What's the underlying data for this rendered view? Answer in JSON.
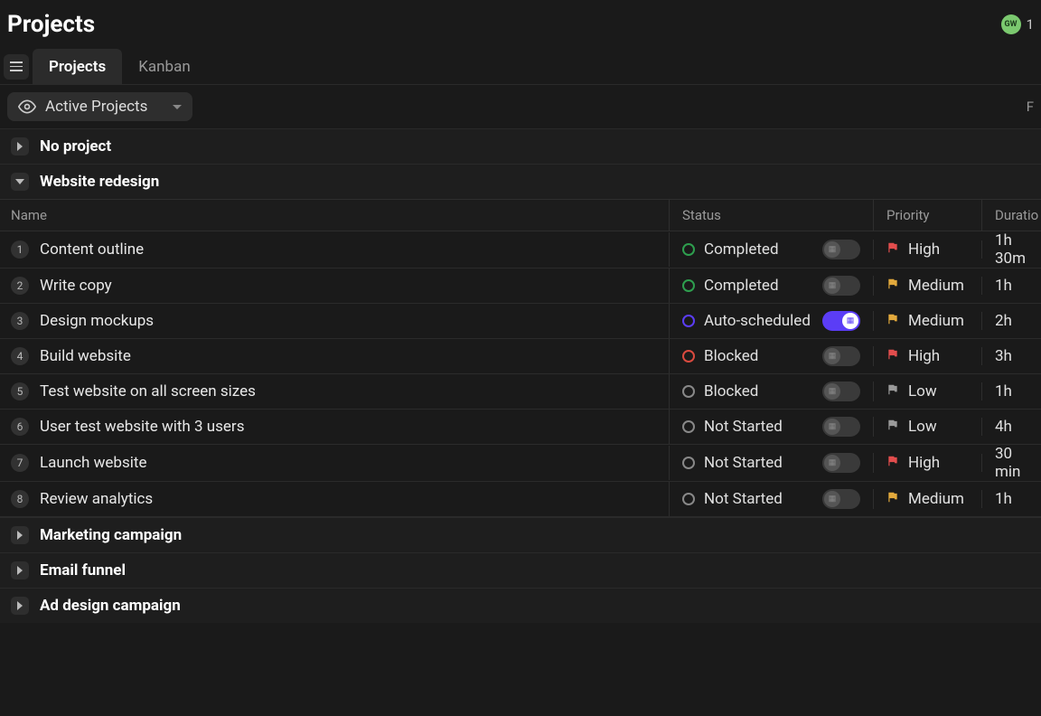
{
  "header": {
    "title": "Projects",
    "avatar_initials": "GW",
    "count_fragment": "1"
  },
  "tabs": [
    {
      "label": "Projects",
      "active": true
    },
    {
      "label": "Kanban",
      "active": false
    }
  ],
  "filter": {
    "label": "Active Projects",
    "right_fragment": "F"
  },
  "columns": {
    "name": "Name",
    "status": "Status",
    "priority": "Priority",
    "duration": "Duratio"
  },
  "groups": [
    {
      "title": "No project",
      "expanded": false
    },
    {
      "title": "Website redesign",
      "expanded": true,
      "tasks": [
        {
          "num": "1",
          "name": "Content outline",
          "status": "Completed",
          "status_color": "#2e9e4e",
          "toggle_on": false,
          "priority": "High",
          "priority_color": "#e24d4d",
          "duration": "1h 30m"
        },
        {
          "num": "2",
          "name": "Write copy",
          "status": "Completed",
          "status_color": "#2e9e4e",
          "toggle_on": false,
          "priority": "Medium",
          "priority_color": "#e2a93c",
          "duration": "1h"
        },
        {
          "num": "3",
          "name": "Design mockups",
          "status": "Auto-scheduled",
          "status_color": "#5b3df6",
          "toggle_on": true,
          "priority": "Medium",
          "priority_color": "#e2a93c",
          "duration": "2h"
        },
        {
          "num": "4",
          "name": "Build website",
          "status": "Blocked",
          "status_color": "#d94a3f",
          "toggle_on": false,
          "priority": "High",
          "priority_color": "#e24d4d",
          "duration": "3h"
        },
        {
          "num": "5",
          "name": "Test website on all screen sizes",
          "status": "Blocked",
          "status_color": "#888",
          "toggle_on": false,
          "priority": "Low",
          "priority_color": "#9a9a9a",
          "duration": "1h"
        },
        {
          "num": "6",
          "name": "User test website with 3 users",
          "status": "Not Started",
          "status_color": "#888",
          "toggle_on": false,
          "priority": "Low",
          "priority_color": "#9a9a9a",
          "duration": "4h"
        },
        {
          "num": "7",
          "name": "Launch website",
          "status": "Not Started",
          "status_color": "#888",
          "toggle_on": false,
          "priority": "High",
          "priority_color": "#e24d4d",
          "duration": "30 min"
        },
        {
          "num": "8",
          "name": "Review analytics",
          "status": "Not Started",
          "status_color": "#888",
          "toggle_on": false,
          "priority": "Medium",
          "priority_color": "#e2a93c",
          "duration": "1h"
        }
      ]
    },
    {
      "title": "Marketing campaign",
      "expanded": false
    },
    {
      "title": "Email funnel",
      "expanded": false
    },
    {
      "title": "Ad design campaign",
      "expanded": false
    }
  ]
}
